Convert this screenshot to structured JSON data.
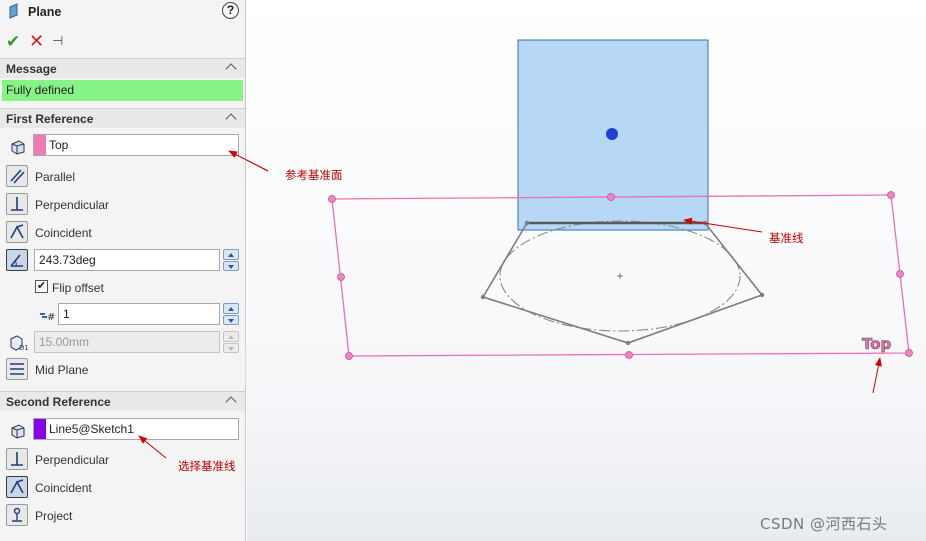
{
  "panel": {
    "title": "Plane",
    "help": "?",
    "actions": {
      "ok": "✔",
      "cancel": "✕",
      "pin": "⊣"
    }
  },
  "message": {
    "header": "Message",
    "text": "Fully defined"
  },
  "first_reference": {
    "header": "First Reference",
    "value": "Top",
    "swatch_color": "#f07ab4",
    "options": {
      "parallel": "Parallel",
      "perpendicular": "Perpendicular",
      "coincident": "Coincident",
      "mid_plane": "Mid Plane"
    },
    "angle": "243.73deg",
    "flip_offset": "Flip offset",
    "flip_checked": "✔",
    "instances": "1",
    "distance": "15.00mm"
  },
  "second_reference": {
    "header": "Second Reference",
    "value": "Line5@Sketch1",
    "swatch_color": "#8a00e6",
    "options": {
      "perpendicular": "Perpendicular",
      "coincident": "Coincident",
      "project": "Project"
    }
  },
  "viewport": {
    "plane_label": "Top",
    "annotations": {
      "reference_plane": "参考基准面",
      "reference_line": "基准线",
      "select_line": "选择基准线"
    },
    "watermark": "CSDN @河西石头"
  }
}
